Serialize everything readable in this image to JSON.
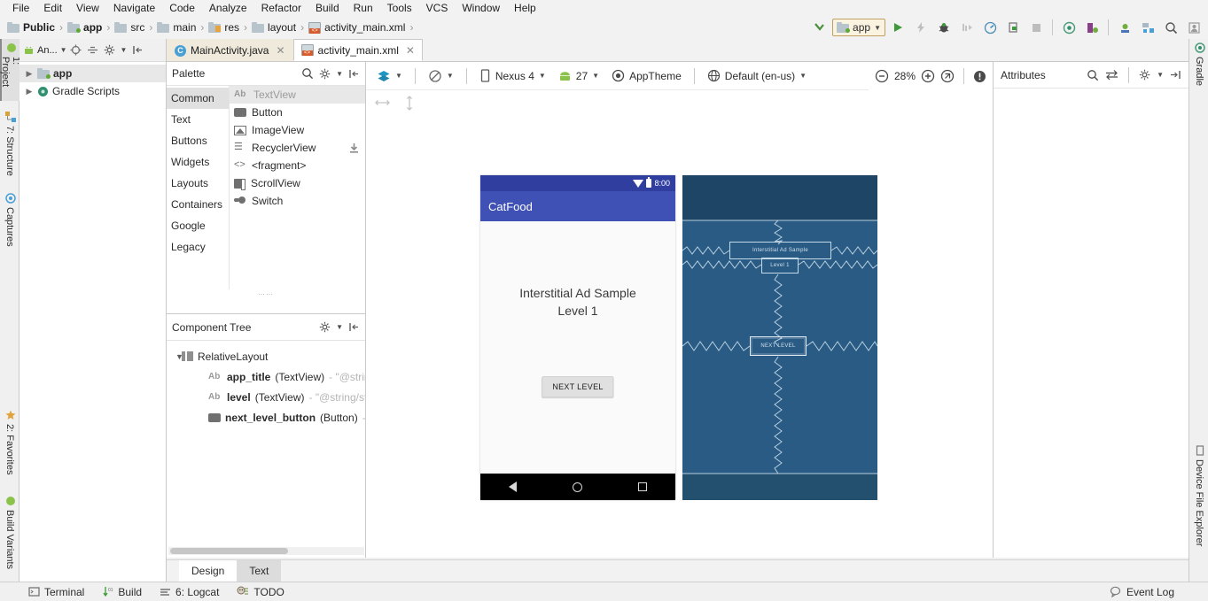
{
  "menu": {
    "items": [
      "File",
      "Edit",
      "View",
      "Navigate",
      "Code",
      "Analyze",
      "Refactor",
      "Build",
      "Run",
      "Tools",
      "VCS",
      "Window",
      "Help"
    ]
  },
  "breadcrumb": {
    "items": [
      {
        "label": "Public",
        "icon": "folder-icon",
        "bold": true
      },
      {
        "label": "app",
        "icon": "module-icon",
        "bold": true
      },
      {
        "label": "src",
        "icon": "folder-icon",
        "bold": false
      },
      {
        "label": "main",
        "icon": "folder-icon",
        "bold": false
      },
      {
        "label": "res",
        "icon": "res-folder-icon",
        "bold": false
      },
      {
        "label": "layout",
        "icon": "folder-icon",
        "bold": false
      },
      {
        "label": "activity_main.xml",
        "icon": "xml-file-icon",
        "bold": false
      }
    ],
    "separator": "›"
  },
  "toolbar": {
    "run_config": "app",
    "buttons": [
      {
        "name": "make-project-button",
        "icon": "hammer-icon"
      },
      {
        "name": "run-button",
        "icon": "play-icon"
      },
      {
        "name": "apply-changes-button",
        "icon": "lightning-icon"
      },
      {
        "name": "debug-button",
        "icon": "bug-icon"
      },
      {
        "name": "run-with-coverage-button",
        "icon": "coverage-icon"
      },
      {
        "name": "profile-button",
        "icon": "gauge-icon"
      },
      {
        "name": "attach-debugger-button",
        "icon": "attach-icon"
      },
      {
        "name": "stop-button",
        "icon": "stop-icon"
      },
      {
        "name": "sync-gradle-button",
        "icon": "sync-icon"
      },
      {
        "name": "avd-manager-button",
        "icon": "avd-icon"
      },
      {
        "name": "sdk-manager-button",
        "icon": "sdk-icon"
      },
      {
        "name": "project-structure-button",
        "icon": "project-structure-icon"
      },
      {
        "name": "search-everywhere-button",
        "icon": "search-icon"
      },
      {
        "name": "layout-inspector-button",
        "icon": "layout-inspector-icon"
      }
    ]
  },
  "left_strip": {
    "tabs": [
      {
        "label": "1: Project",
        "selected": true,
        "icon": "android-icon"
      },
      {
        "label": "7: Structure",
        "selected": false,
        "icon": "structure-icon"
      },
      {
        "label": "Captures",
        "selected": false,
        "icon": "captures-icon"
      },
      {
        "label": "2: Favorites",
        "selected": false,
        "icon": "star-icon"
      },
      {
        "label": "Build Variants",
        "selected": false,
        "icon": "variants-icon"
      }
    ]
  },
  "right_strip": {
    "tabs": [
      {
        "label": "Gradle",
        "icon": "gradle-icon"
      },
      {
        "label": "Device File Explorer",
        "icon": "device-icon"
      }
    ]
  },
  "project_panel": {
    "title": "An...",
    "tools": [
      {
        "name": "locate-file-button",
        "icon": "target-icon"
      },
      {
        "name": "collapse-all-button",
        "icon": "collapse-icon"
      },
      {
        "name": "settings-button",
        "icon": "gear-icon"
      },
      {
        "name": "hide-panel-button",
        "icon": "hide-icon"
      }
    ],
    "tree": [
      {
        "label": "app",
        "bold": true,
        "icon": "module-icon",
        "expanded": false,
        "selected": true
      },
      {
        "label": "Gradle Scripts",
        "bold": false,
        "icon": "gradle-icon",
        "expanded": false,
        "selected": false
      }
    ]
  },
  "editor_tabs": [
    {
      "label": "MainActivity.java",
      "icon": "java-class-icon",
      "active": false
    },
    {
      "label": "activity_main.xml",
      "icon": "xml-layout-icon",
      "active": true
    }
  ],
  "palette": {
    "title": "Palette",
    "tools": [
      {
        "name": "palette-search-icon",
        "icon": "search-icon"
      },
      {
        "name": "palette-gear-icon",
        "icon": "gear-icon"
      },
      {
        "name": "palette-hide-icon",
        "icon": "hide-icon"
      }
    ],
    "categories": [
      {
        "label": "Common",
        "selected": true
      },
      {
        "label": "Text",
        "selected": false
      },
      {
        "label": "Buttons",
        "selected": false
      },
      {
        "label": "Widgets",
        "selected": false
      },
      {
        "label": "Layouts",
        "selected": false
      },
      {
        "label": "Containers",
        "selected": false
      },
      {
        "label": "Google",
        "selected": false
      },
      {
        "label": "Legacy",
        "selected": false
      }
    ],
    "items": [
      {
        "label": "TextView",
        "icon": "ab-text-icon",
        "selected": true,
        "download": false
      },
      {
        "label": "Button",
        "icon": "button-icon",
        "selected": false,
        "download": false
      },
      {
        "label": "ImageView",
        "icon": "image-icon",
        "selected": false,
        "download": false
      },
      {
        "label": "RecyclerView",
        "icon": "list-icon",
        "selected": false,
        "download": true
      },
      {
        "label": "<fragment>",
        "icon": "fragment-icon",
        "selected": false,
        "download": false
      },
      {
        "label": "ScrollView",
        "icon": "scrollview-icon",
        "selected": false,
        "download": false
      },
      {
        "label": "Switch",
        "icon": "switch-icon",
        "selected": false,
        "download": false
      }
    ]
  },
  "component_tree": {
    "title": "Component Tree",
    "tools": [
      {
        "name": "component-tree-gear-icon",
        "icon": "gear-icon"
      },
      {
        "name": "component-tree-hide-icon",
        "icon": "hide-icon"
      }
    ],
    "rows": [
      {
        "name": "RelativeLayout",
        "type": "",
        "value": "",
        "icon": "relative-layout-icon",
        "chevron": "⌄",
        "indent": 1
      },
      {
        "name": "app_title",
        "type": " (TextView)",
        "value": " - \"@strin",
        "icon": "ab-text-icon",
        "chevron": "",
        "indent": 2
      },
      {
        "name": "level",
        "type": " (TextView)",
        "value": " - \"@string/st",
        "icon": "ab-text-icon",
        "chevron": "",
        "indent": 2
      },
      {
        "name": "next_level_button",
        "type": " (Button)",
        "value": " -",
        "icon": "button-icon",
        "chevron": "",
        "indent": 2
      }
    ]
  },
  "surface_toolbar": {
    "design_mode": {
      "label": "",
      "icon": "layers-icon"
    },
    "orientation": {
      "label": "",
      "icon": "rotate-icon"
    },
    "device": {
      "label": "Nexus 4",
      "icon": "phone-icon"
    },
    "api_level": {
      "label": "27",
      "icon": "android-head-icon"
    },
    "theme": {
      "label": "AppTheme",
      "icon": "theme-icon"
    },
    "locale": {
      "label": "Default (en-us)",
      "icon": "globe-icon"
    },
    "zoom": {
      "value": "28%",
      "out_icon": "zoom-out-icon",
      "in_icon": "zoom-in-icon",
      "fit_icon": "zoom-fit-icon"
    },
    "issues": {
      "icon": "warning-icon"
    },
    "constraints": [
      {
        "name": "horizontal-guideline-icon",
        "icon": "horizontal-arrows-icon"
      },
      {
        "name": "vertical-guideline-icon",
        "icon": "vertical-arrows-icon"
      }
    ]
  },
  "preview": {
    "status_time": "8:00",
    "app_bar_title": "CatFood",
    "title_line1": "Interstitial Ad Sample",
    "title_line2": "Level 1",
    "button_label": "NEXT LEVEL",
    "nav_buttons": [
      "back-icon",
      "home-icon",
      "recents-icon"
    ],
    "colors": {
      "status_bar": "#303f9f",
      "app_bar": "#3f51b5",
      "content": "#fafafa",
      "nav_bar": "#000000",
      "blueprint_bg": "#2a5b84",
      "blueprint_band": "#1e4565",
      "blueprint_stroke": "#b7cfe0"
    }
  },
  "blueprint": {
    "labels": {
      "title": "Interstitial Ad Sample",
      "level": "Level 1",
      "button": "NEXT LEVEL"
    }
  },
  "attributes": {
    "title": "Attributes",
    "tools": [
      {
        "name": "attributes-search-icon",
        "icon": "search-icon"
      },
      {
        "name": "attributes-toggle-icon",
        "icon": "swap-icon"
      },
      {
        "name": "attributes-gear-icon",
        "icon": "gear-icon"
      },
      {
        "name": "attributes-hide-icon",
        "icon": "hide-icon"
      }
    ]
  },
  "bottom_tabs": [
    {
      "label": "Design",
      "active": true
    },
    {
      "label": "Text",
      "active": false
    }
  ],
  "status_bar": {
    "left_items": [
      {
        "label": "Terminal",
        "icon": "terminal-icon"
      },
      {
        "label": "Build",
        "icon": "build-icon"
      },
      {
        "label": "6: Logcat",
        "icon": "logcat-icon"
      },
      {
        "label": "TODO",
        "icon": "todo-icon"
      }
    ],
    "right_items": [
      {
        "label": "Event Log",
        "icon": "event-log-icon"
      }
    ]
  }
}
